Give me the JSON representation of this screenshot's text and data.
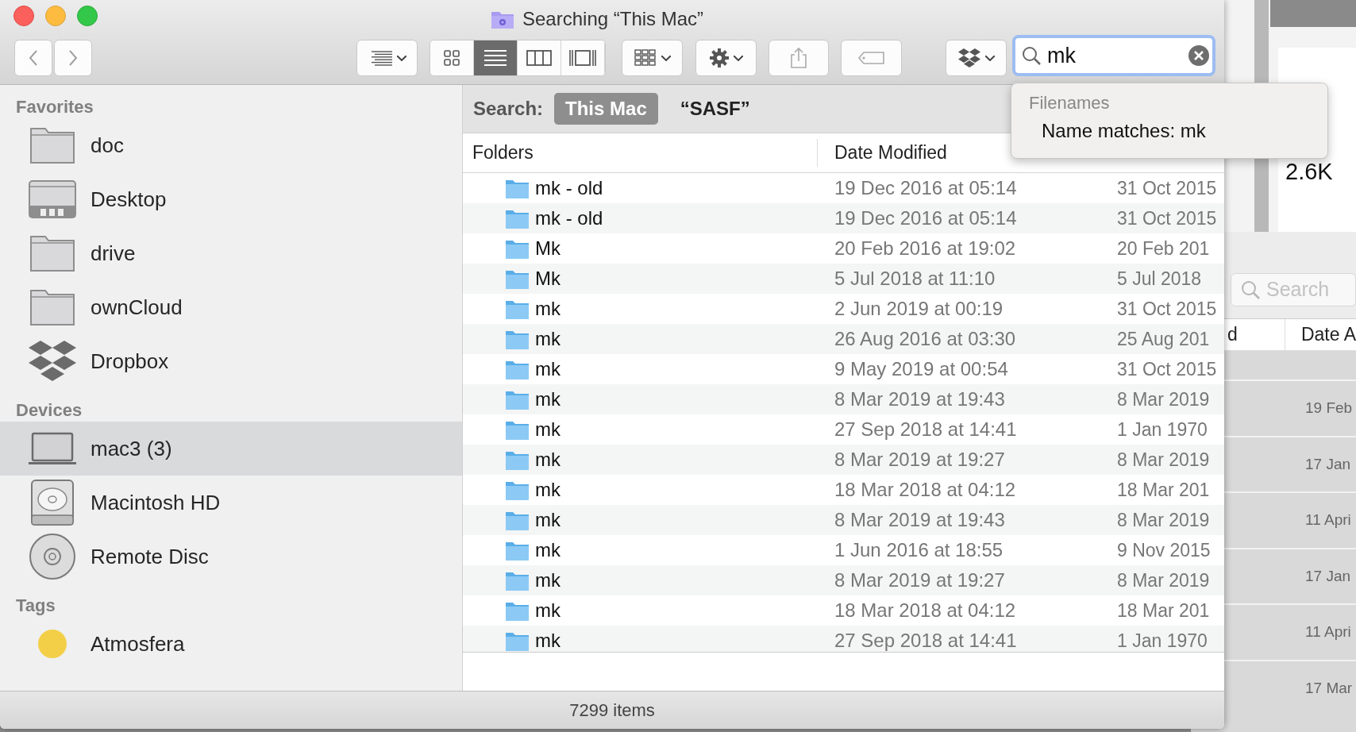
{
  "window": {
    "title": "Searching “This Mac”"
  },
  "toolbar": {
    "view_modes": [
      {
        "kind": "icon",
        "selected": false
      },
      {
        "kind": "list",
        "selected": true
      },
      {
        "kind": "column",
        "selected": false
      },
      {
        "kind": "gallery",
        "selected": false
      }
    ]
  },
  "search": {
    "value": "mk",
    "suggestions": {
      "heading": "Filenames",
      "items": [
        "Name matches: mk"
      ]
    }
  },
  "scope_bar": {
    "label": "Search:",
    "scopes": [
      {
        "label": "This Mac",
        "selected": true
      },
      {
        "label": "“SASF”",
        "selected": false
      }
    ]
  },
  "sidebar": {
    "sections": [
      {
        "title": "Favorites",
        "items": [
          {
            "label": "doc",
            "kind": "folder",
            "selected": false
          },
          {
            "label": "Desktop",
            "kind": "desktop",
            "selected": false
          },
          {
            "label": "drive",
            "kind": "folder",
            "selected": false
          },
          {
            "label": "ownCloud",
            "kind": "folder",
            "selected": false
          },
          {
            "label": "Dropbox",
            "kind": "dropbox",
            "selected": false
          }
        ]
      },
      {
        "title": "Devices",
        "items": [
          {
            "label": "mac3 (3)",
            "kind": "laptop",
            "selected": true
          },
          {
            "label": "Macintosh HD",
            "kind": "disk",
            "selected": false
          },
          {
            "label": "Remote Disc",
            "kind": "disc",
            "selected": false
          }
        ]
      },
      {
        "title": "Tags",
        "items": [
          {
            "label": "Atmosfera",
            "kind": "tag",
            "color": "#f3cf48",
            "selected": false
          }
        ]
      }
    ]
  },
  "table": {
    "columns": [
      "Folders",
      "Date Modified"
    ],
    "rows": [
      {
        "name": "mk - old",
        "modified": "19 Dec 2016 at 05:14",
        "created": "31 Oct 2015"
      },
      {
        "name": "mk - old",
        "modified": "19 Dec 2016 at 05:14",
        "created": "31 Oct 2015"
      },
      {
        "name": "Mk",
        "modified": "20 Feb 2016 at 19:02",
        "created": "20 Feb 201"
      },
      {
        "name": "Mk",
        "modified": "5 Jul 2018 at 11:10",
        "created": "5 Jul 2018"
      },
      {
        "name": "mk",
        "modified": "2 Jun 2019 at 00:19",
        "created": "31 Oct 2015"
      },
      {
        "name": "mk",
        "modified": "26 Aug 2016 at 03:30",
        "created": "25 Aug 201"
      },
      {
        "name": "mk",
        "modified": "9 May 2019 at 00:54",
        "created": "31 Oct 2015"
      },
      {
        "name": "mk",
        "modified": "8 Mar 2019 at 19:43",
        "created": "8 Mar 2019"
      },
      {
        "name": "mk",
        "modified": "27 Sep 2018 at 14:41",
        "created": "1 Jan 1970"
      },
      {
        "name": "mk",
        "modified": "8 Mar 2019 at 19:27",
        "created": "8 Mar 2019"
      },
      {
        "name": "mk",
        "modified": "18 Mar 2018 at 04:12",
        "created": "18 Mar 201"
      },
      {
        "name": "mk",
        "modified": "8 Mar 2019 at 19:43",
        "created": "8 Mar 2019"
      },
      {
        "name": "mk",
        "modified": "1 Jun 2016 at 18:55",
        "created": "9 Nov 2015"
      },
      {
        "name": "mk",
        "modified": "8 Mar 2019 at 19:27",
        "created": "8 Mar 2019"
      },
      {
        "name": "mk",
        "modified": "18 Mar 2018 at 04:12",
        "created": "18 Mar 201"
      },
      {
        "name": "mk",
        "modified": "27 Sep 2018 at 14:41",
        "created": "1 Jan 1970"
      }
    ]
  },
  "status_bar": "7299 items",
  "background_windows": {
    "size_label": "2.6K",
    "search": {
      "placeholder": "Search"
    },
    "columns": [
      "d",
      "Date A"
    ],
    "rows": [
      "19 Feb",
      "17 Jan",
      "11 Apri",
      "17 Jan",
      "11 Apri",
      "17 Mar"
    ]
  }
}
